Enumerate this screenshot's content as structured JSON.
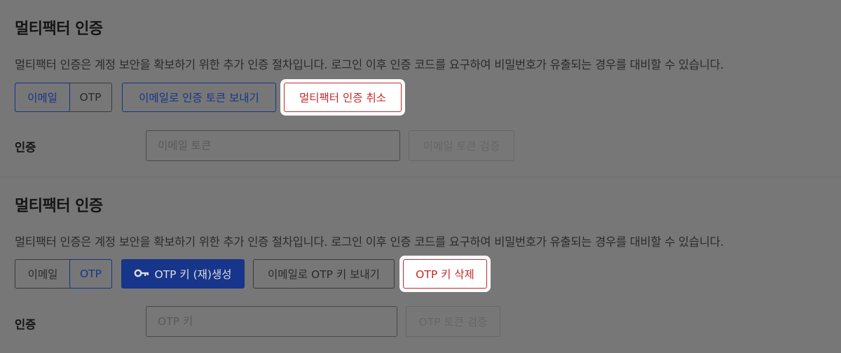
{
  "section_email": {
    "title": "멀티팩터 인증",
    "description": "멀티팩터 인증은 계정 보안을 확보하기 위한 추가 인증 절차입니다. 로그인 이후 인증 코드를 요구하여 비밀번호가 유출되는 경우를 대비할 수 있습니다.",
    "toggle": {
      "email_label": "이메일",
      "otp_label": "OTP",
      "active": "email"
    },
    "send_token_button": "이메일로 인증 토큰 보내기",
    "cancel_mfa_button": "멀티팩터 인증 취소",
    "auth_label": "인증",
    "token_input_placeholder": "이메일 토큰",
    "verify_button": "이메일 토큰 검증"
  },
  "section_otp": {
    "title": "멀티팩터 인증",
    "description": "멀티팩터 인증은 계정 보안을 확보하기 위한 추가 인증 절차입니다. 로그인 이후 인증 코드를 요구하여 비밀번호가 유출되는 경우를 대비할 수 있습니다.",
    "toggle": {
      "email_label": "이메일",
      "otp_label": "OTP",
      "active": "otp"
    },
    "generate_key_button": "OTP 키 (재)생성",
    "generate_key_icon": "key-icon",
    "email_key_button": "이메일로 OTP 키 보내기",
    "delete_key_button": "OTP 키 삭제",
    "auth_label": "인증",
    "key_input_placeholder": "OTP 키",
    "verify_button": "OTP 토큰 검증"
  },
  "colors": {
    "overlay_background": "#777777",
    "primary": "#17358a",
    "danger": "#c62828",
    "highlight": "#ffffff"
  }
}
